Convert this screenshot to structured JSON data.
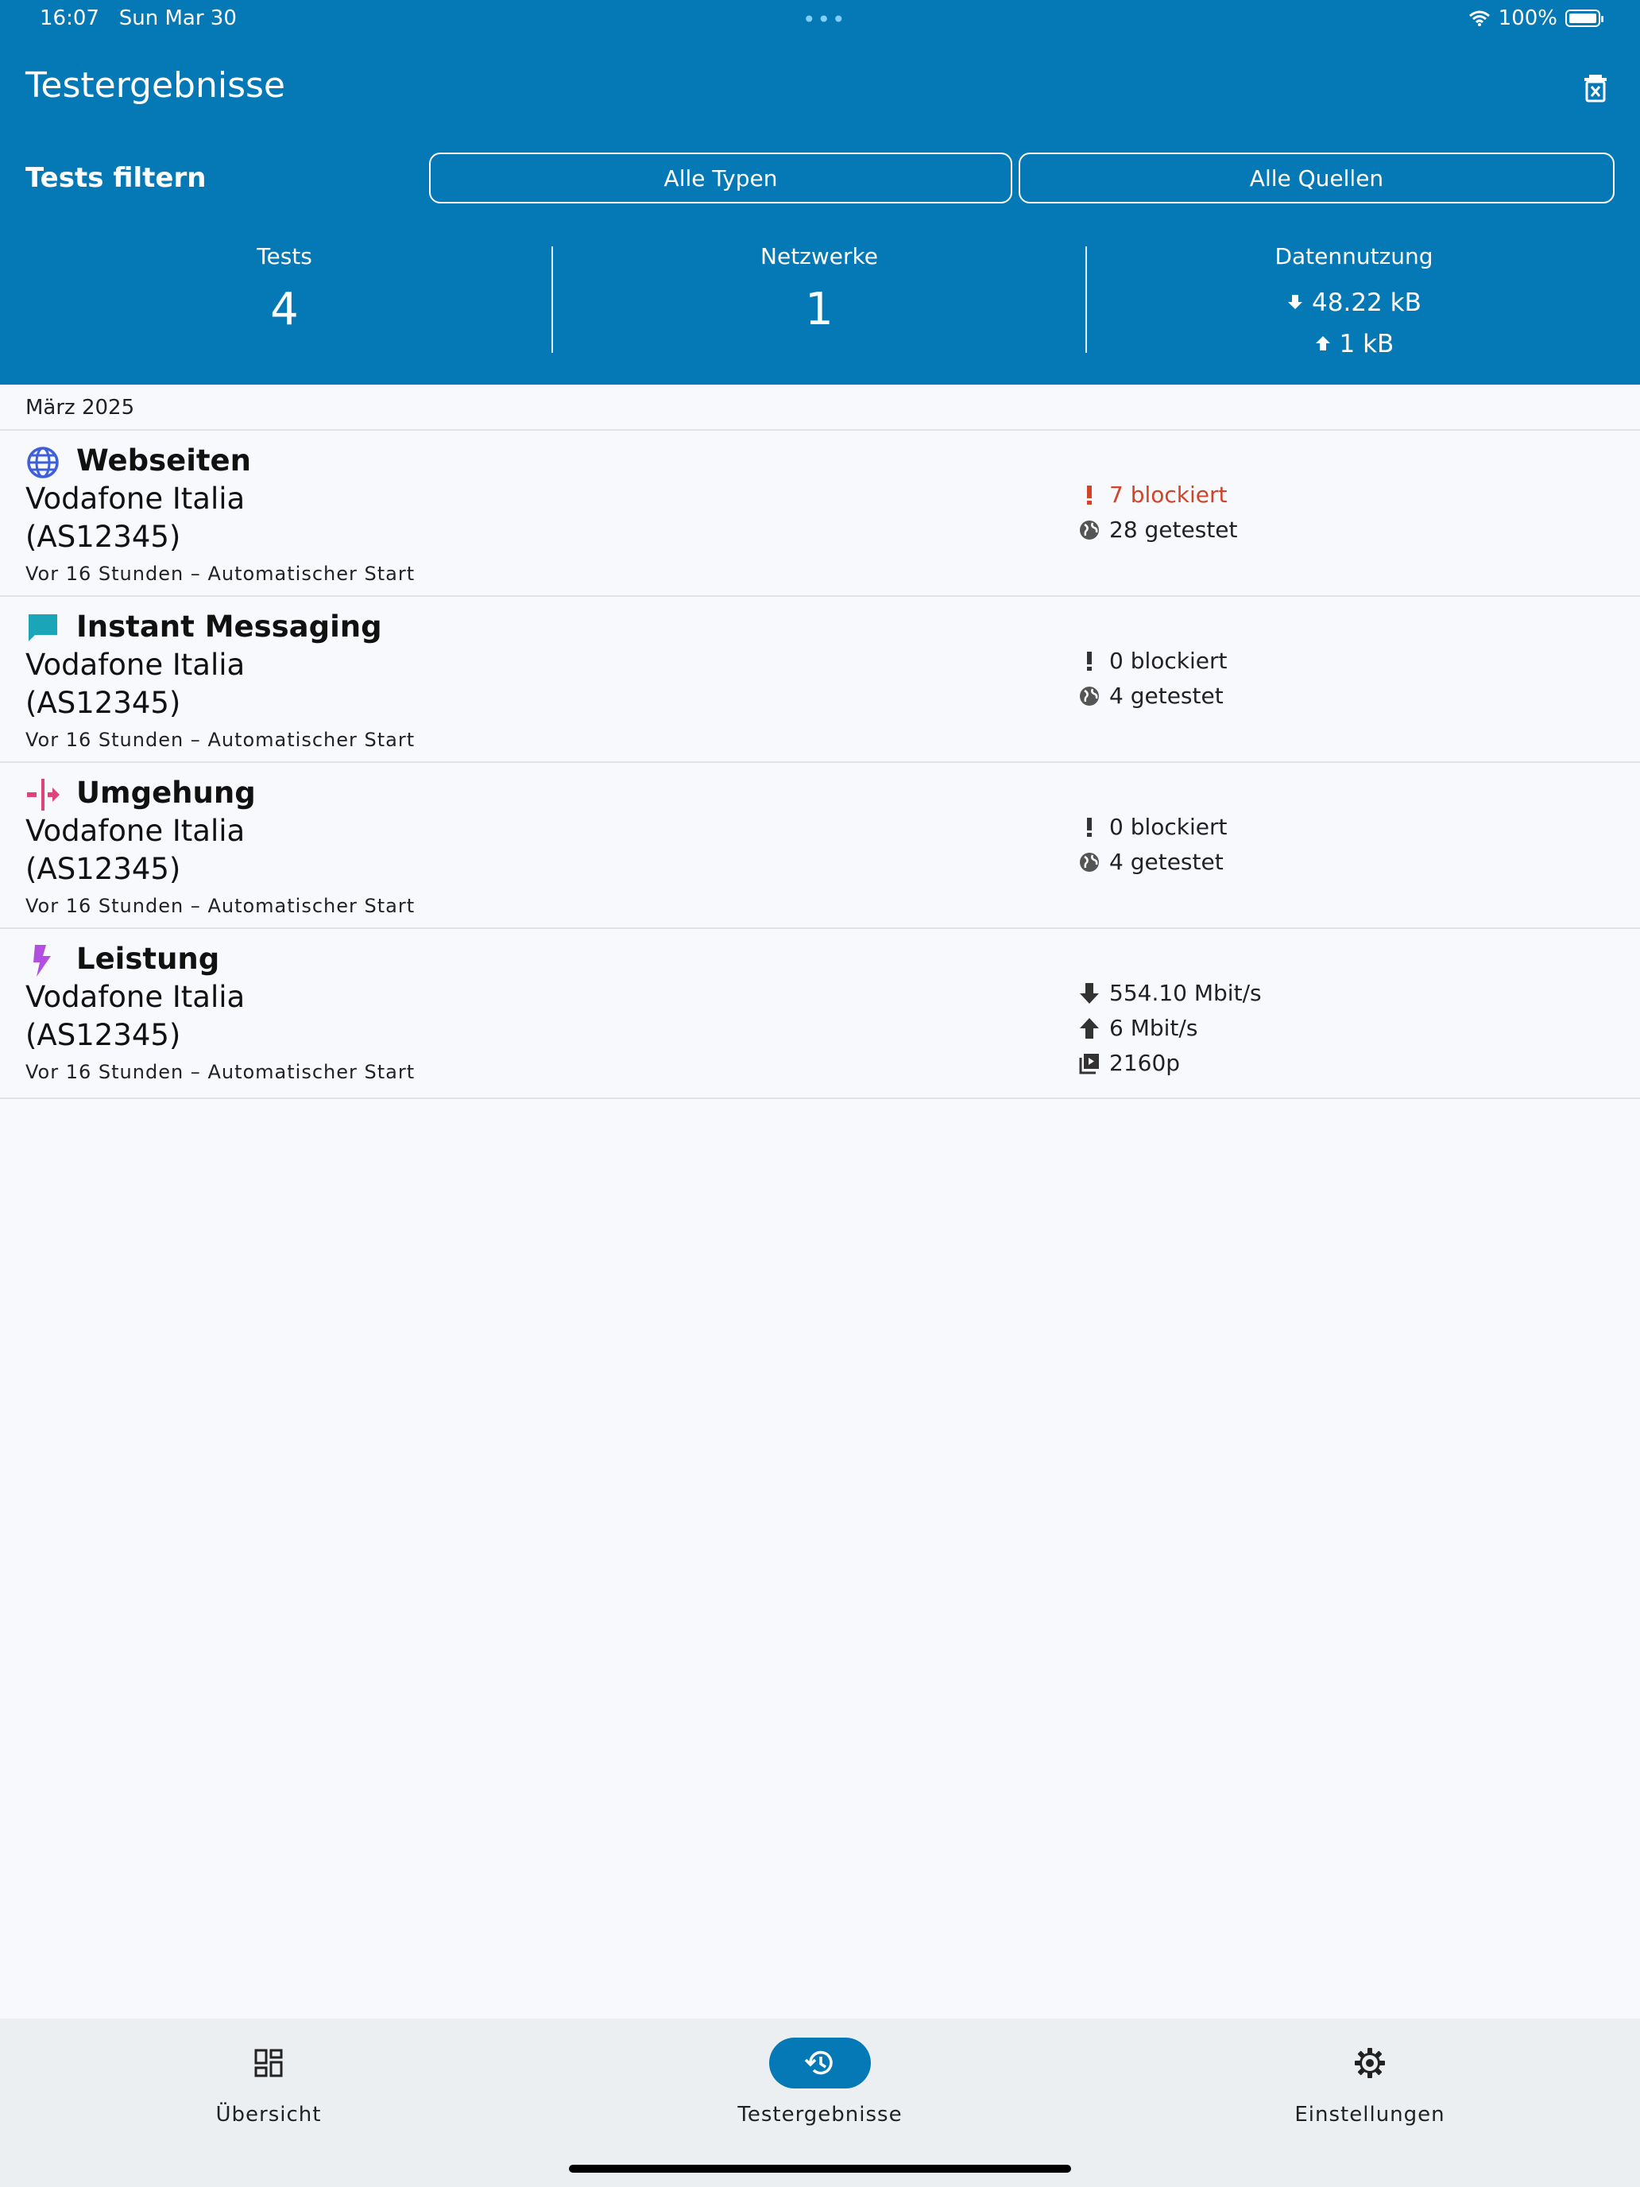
{
  "status_bar": {
    "time": "16:07",
    "date": "Sun Mar 30",
    "battery": "100%",
    "dots": "•••"
  },
  "header": {
    "title": "Testergebnisse",
    "filter_label": "Tests filtern",
    "filter_types": "Alle Typen",
    "filter_sources": "Alle Quellen",
    "stats": {
      "tests_label": "Tests",
      "tests_value": "4",
      "networks_label": "Netzwerke",
      "networks_value": "1",
      "usage_label": "Datennutzung",
      "usage_down": "48.22 kB",
      "usage_up": "1 kB"
    }
  },
  "section": {
    "month": "März 2025"
  },
  "results": [
    {
      "name": "Webseiten",
      "network": "Vodafone Italia",
      "asn": "(AS12345)",
      "meta": "Vor 16 Stunden – Automatischer Start",
      "icon": "globe-icon",
      "color": "#3d5fd8",
      "blocked": "7 blockiert",
      "tested": "28 getestet"
    },
    {
      "name": "Instant Messaging",
      "network": "Vodafone Italia",
      "asn": "(AS12345)",
      "meta": "Vor 16 Stunden – Automatischer Start",
      "icon": "chat-icon",
      "color": "#1aa6b8",
      "blocked": "0 blockiert",
      "tested": "4 getestet"
    },
    {
      "name": "Umgehung",
      "network": "Vodafone Italia",
      "asn": "(AS12345)",
      "meta": "Vor 16 Stunden – Automatischer Start",
      "icon": "circumvention-icon",
      "color": "#e0437a",
      "blocked": "0 blockiert",
      "tested": "4 getestet"
    },
    {
      "name": "Leistung",
      "network": "Vodafone Italia",
      "asn": "(AS12345)",
      "meta": "Vor 16 Stunden – Automatischer Start",
      "icon": "bolt-icon",
      "color": "#b24ee0",
      "download": "554.10 Mbit/s",
      "upload": "6 Mbit/s",
      "video": "2160p"
    }
  ],
  "nav": {
    "overview": "Übersicht",
    "results": "Testergebnisse",
    "settings": "Einstellungen"
  },
  "colors": {
    "header_bg": "#0578b6",
    "warning": "#d2442a",
    "nav_bg": "#ebeff2"
  }
}
